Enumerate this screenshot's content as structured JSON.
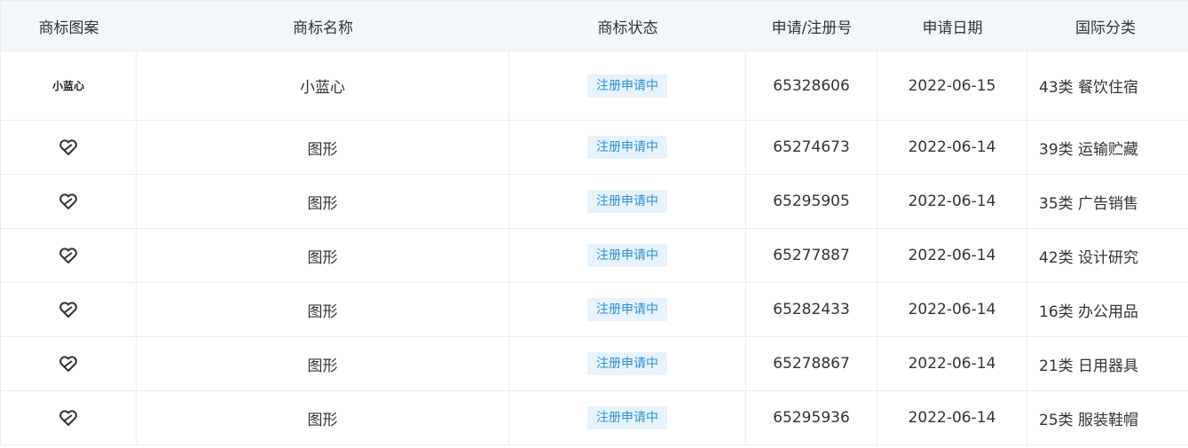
{
  "headers": [
    "商标图案",
    "商标名称",
    "商标状态",
    "申请/注册号",
    "申请日期",
    "国际分类"
  ],
  "rows": [
    {
      "pattern_text": "小蓝心",
      "name": "小蓝心",
      "status": "注册申请中",
      "number": "65328606",
      "date": "2022-06-15",
      "class": "43类 餐饮住宿"
    },
    {
      "pattern_icon": "heart-mark-icon",
      "name": "图形",
      "status": "注册申请中",
      "number": "65274673",
      "date": "2022-06-14",
      "class": "39类 运输贮藏"
    },
    {
      "pattern_icon": "heart-mark-icon",
      "name": "图形",
      "status": "注册申请中",
      "number": "65295905",
      "date": "2022-06-14",
      "class": "35类 广告销售"
    },
    {
      "pattern_icon": "heart-mark-icon",
      "name": "图形",
      "status": "注册申请中",
      "number": "65277887",
      "date": "2022-06-14",
      "class": "42类 设计研究"
    },
    {
      "pattern_icon": "heart-mark-icon",
      "name": "图形",
      "status": "注册申请中",
      "number": "65282433",
      "date": "2022-06-14",
      "class": "16类 办公用品"
    },
    {
      "pattern_icon": "heart-mark-icon",
      "name": "图形",
      "status": "注册申请中",
      "number": "65278867",
      "date": "2022-06-14",
      "class": "21类 日用器具"
    },
    {
      "pattern_icon": "heart-mark-icon",
      "name": "图形",
      "status": "注册申请中",
      "number": "65295936",
      "date": "2022-06-14",
      "class": "25类 服装鞋帽"
    }
  ],
  "colors": {
    "header_bg": "#f1f7fb",
    "tag_bg": "#e6f3fc",
    "tag_text": "#2b8fd8",
    "border": "#e8eef3"
  }
}
